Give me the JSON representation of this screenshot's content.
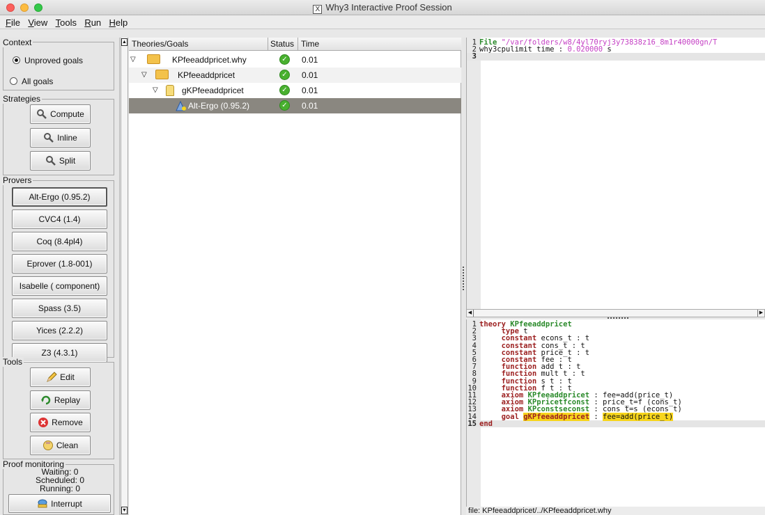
{
  "window": {
    "title": "Why3 Interactive Proof Session"
  },
  "menu": [
    {
      "first": "F",
      "rest": "ile"
    },
    {
      "first": "V",
      "rest": "iew"
    },
    {
      "first": "T",
      "rest": "ools"
    },
    {
      "first": "R",
      "rest": "un"
    },
    {
      "first": "H",
      "rest": "elp"
    }
  ],
  "context": {
    "title": "Context",
    "options": [
      "Unproved goals",
      "All goals"
    ],
    "selected": "Unproved goals"
  },
  "strategies": {
    "title": "Strategies",
    "buttons": [
      "Compute",
      "Inline",
      "Split"
    ]
  },
  "provers": {
    "title": "Provers",
    "buttons": [
      "Alt-Ergo (0.95.2)",
      "CVC4 (1.4)",
      "Coq (8.4pl4)",
      "Eprover (1.8-001)",
      "Isabelle ( component)",
      "Spass (3.5)",
      "Yices (2.2.2)",
      "Z3 (4.3.1)"
    ]
  },
  "tools": {
    "title": "Tools",
    "buttons": [
      "Edit",
      "Replay",
      "Remove",
      "Clean"
    ]
  },
  "monitoring": {
    "title": "Proof monitoring",
    "waiting": "Waiting: 0",
    "scheduled": "Scheduled: 0",
    "running": "Running: 0",
    "interrupt": "Interrupt"
  },
  "tree": {
    "headers": {
      "goals": "Theories/Goals",
      "status": "Status",
      "time": "Time"
    },
    "rows": [
      {
        "label": "KPfeeaddpricet.why",
        "time": "0.01"
      },
      {
        "label": "KPfeeaddpricet",
        "time": "0.01"
      },
      {
        "label": "gKPfeeaddpricet",
        "time": "0.01"
      },
      {
        "label": "Alt-Ergo (0.95.2)",
        "time": "0.01"
      }
    ]
  },
  "task_pane": {
    "line1_num": "1",
    "line1_kw": "File",
    "line1_str": "\"/var/folders/w8/4yl70ryj3y73838z16_8m1r40000gn/T",
    "line2_num": "2",
    "line2_a": "why3cpulimit time : ",
    "line2_num_val": "0.020000",
    "line2_b": " s",
    "line3_num": "3"
  },
  "source": {
    "theory_kw": "theory",
    "theory_name": "KPfeeaddpricet",
    "lines": [
      {
        "n": "2",
        "kw": "type",
        "rest": " t"
      },
      {
        "n": "3",
        "kw": "constant",
        "rest": " econs_t : t"
      },
      {
        "n": "4",
        "kw": "constant",
        "rest": " cons_t : t"
      },
      {
        "n": "5",
        "kw": "constant",
        "rest": " price_t : t"
      },
      {
        "n": "6",
        "kw": "constant",
        "rest": " fee : t"
      },
      {
        "n": "7",
        "kw": "function",
        "rest": " add t : t"
      },
      {
        "n": "8",
        "kw": "function",
        "rest": " mult t : t"
      },
      {
        "n": "9",
        "kw": "function",
        "rest": " s t : t"
      },
      {
        "n": "10",
        "kw": "function",
        "rest": " f t : t"
      }
    ],
    "axioms": [
      {
        "n": "11",
        "kw": "axiom",
        "name": "KPfeeaddpricet",
        "rest": " : fee=add(price_t)"
      },
      {
        "n": "12",
        "kw": "axiom",
        "name": "KPpricetfconst",
        "rest": " : price_t=f (cons_t)"
      },
      {
        "n": "13",
        "kw": "axiom",
        "name": "KPconstseconst",
        "rest": " : cons_t=s (econs_t)"
      }
    ],
    "goal": {
      "n": "14",
      "kw": "goal",
      "name": "gKPfeeaddpricet",
      "sep": " : ",
      "expr": "fee=add(price_t)"
    },
    "end": {
      "n": "15",
      "kw": "end"
    },
    "n1": "1"
  },
  "statusbar": "file: KPfeeaddpricet/../KPfeeaddpricet.why"
}
